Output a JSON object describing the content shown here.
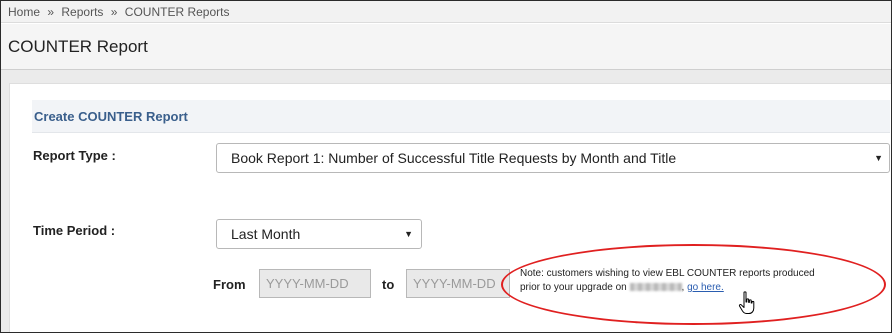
{
  "breadcrumb": {
    "home": "Home",
    "reports": "Reports",
    "counter_reports": "COUNTER Reports",
    "separator": "»"
  },
  "page": {
    "title": "COUNTER Report"
  },
  "panel": {
    "heading": "Create COUNTER Report"
  },
  "form": {
    "report_type_label": "Report Type :",
    "report_type_value": "Book Report 1: Number of Successful Title Requests by Month and Title",
    "time_period_label": "Time Period :",
    "time_period_value": "Last Month",
    "from_label": "From",
    "from_placeholder": "YYYY-MM-DD",
    "to_label": "to",
    "to_placeholder": "YYYY-MM-DD"
  },
  "note": {
    "line1": "Note: customers wishing to view EBL COUNTER reports produced",
    "line2_prefix": "prior to your upgrade on",
    "link": "go here."
  },
  "icons": {
    "select_caret": "caret-down-icon",
    "cursor": "hand-pointer-icon"
  },
  "colors": {
    "heading_text": "#3a5f8c",
    "highlight": "#e02020",
    "link": "#2a5db0"
  }
}
